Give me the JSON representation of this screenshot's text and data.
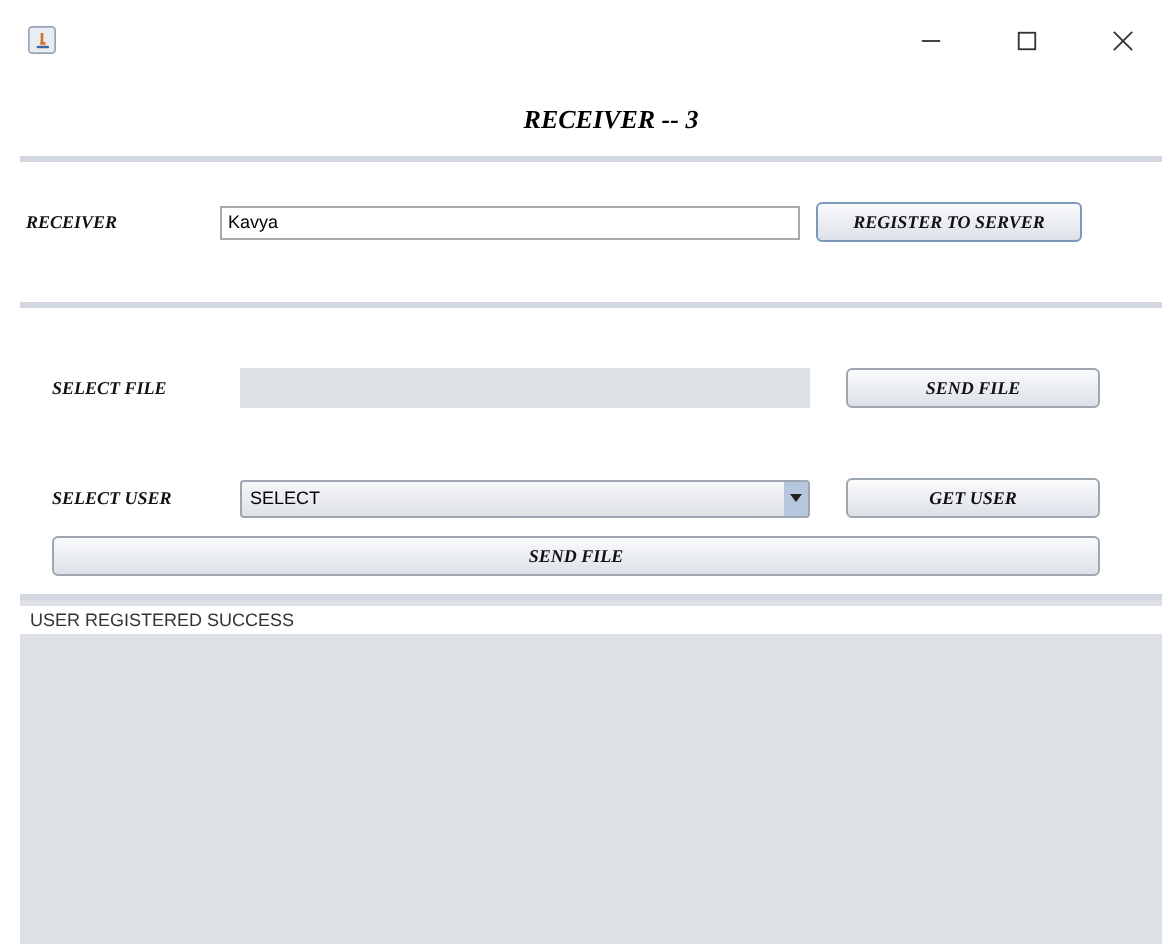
{
  "heading": "RECEIVER -- 3",
  "receiver": {
    "label": "RECEIVER",
    "value": "Kavya",
    "button": "REGISTER TO SERVER"
  },
  "file_row": {
    "label": "SELECT FILE",
    "button": "SEND FILE"
  },
  "user_row": {
    "label": "SELECT USER",
    "value": "SELECT",
    "button": "GET USER"
  },
  "send_button": "SEND FILE",
  "log": {
    "lines": [
      "USER REGISTERED SUCCESS"
    ]
  }
}
